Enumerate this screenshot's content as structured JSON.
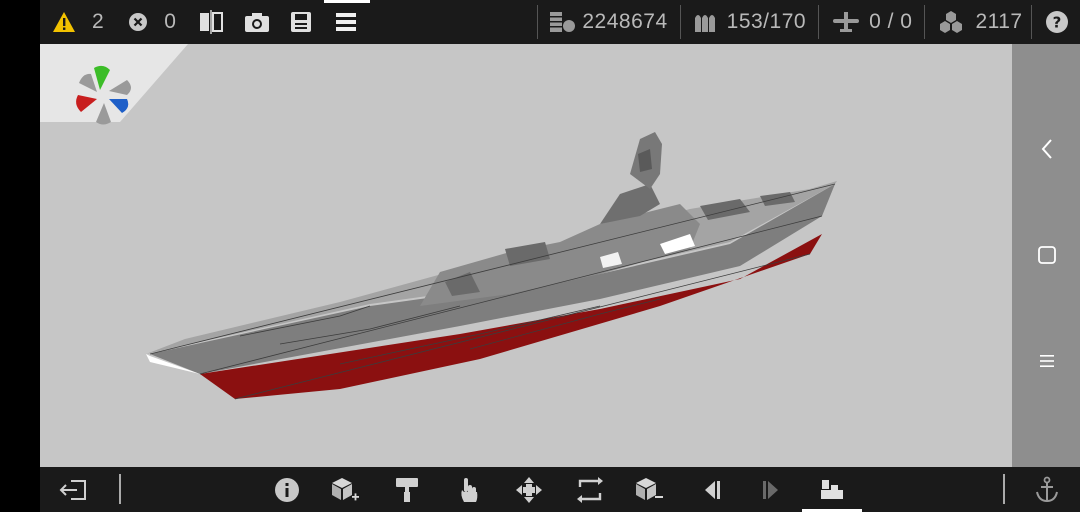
{
  "topbar": {
    "warnings_count": "2",
    "errors_count": "0",
    "displacement": "2248674",
    "ammo": "153/170",
    "aircraft": "0 / 0",
    "parts": "2117",
    "icons": [
      "warning-icon",
      "error-icon",
      "mirror-icon",
      "camera-icon",
      "save-icon",
      "menu-icon",
      "displacement-icon",
      "ammo-icon",
      "aircraft-icon",
      "parts-icon",
      "help-icon"
    ],
    "warning_color": "#f2c200"
  },
  "right_panel": {
    "buttons": [
      "back-icon",
      "recent-apps-icon",
      "menu-lines-icon"
    ]
  },
  "bottom_bar": {
    "tools": [
      "exit-icon",
      "info-icon",
      "add-block-icon",
      "paint-icon",
      "select-hand-icon",
      "move-icon",
      "rotate-icon",
      "remove-block-icon",
      "previous-icon",
      "next-icon",
      "build-mode-icon",
      "anchor-icon"
    ],
    "active_tool": "build-mode-icon"
  },
  "viewport": {
    "background": "#c6c6c6",
    "hull_color": "#8f8f8f",
    "hull_red": "#8b1010"
  }
}
